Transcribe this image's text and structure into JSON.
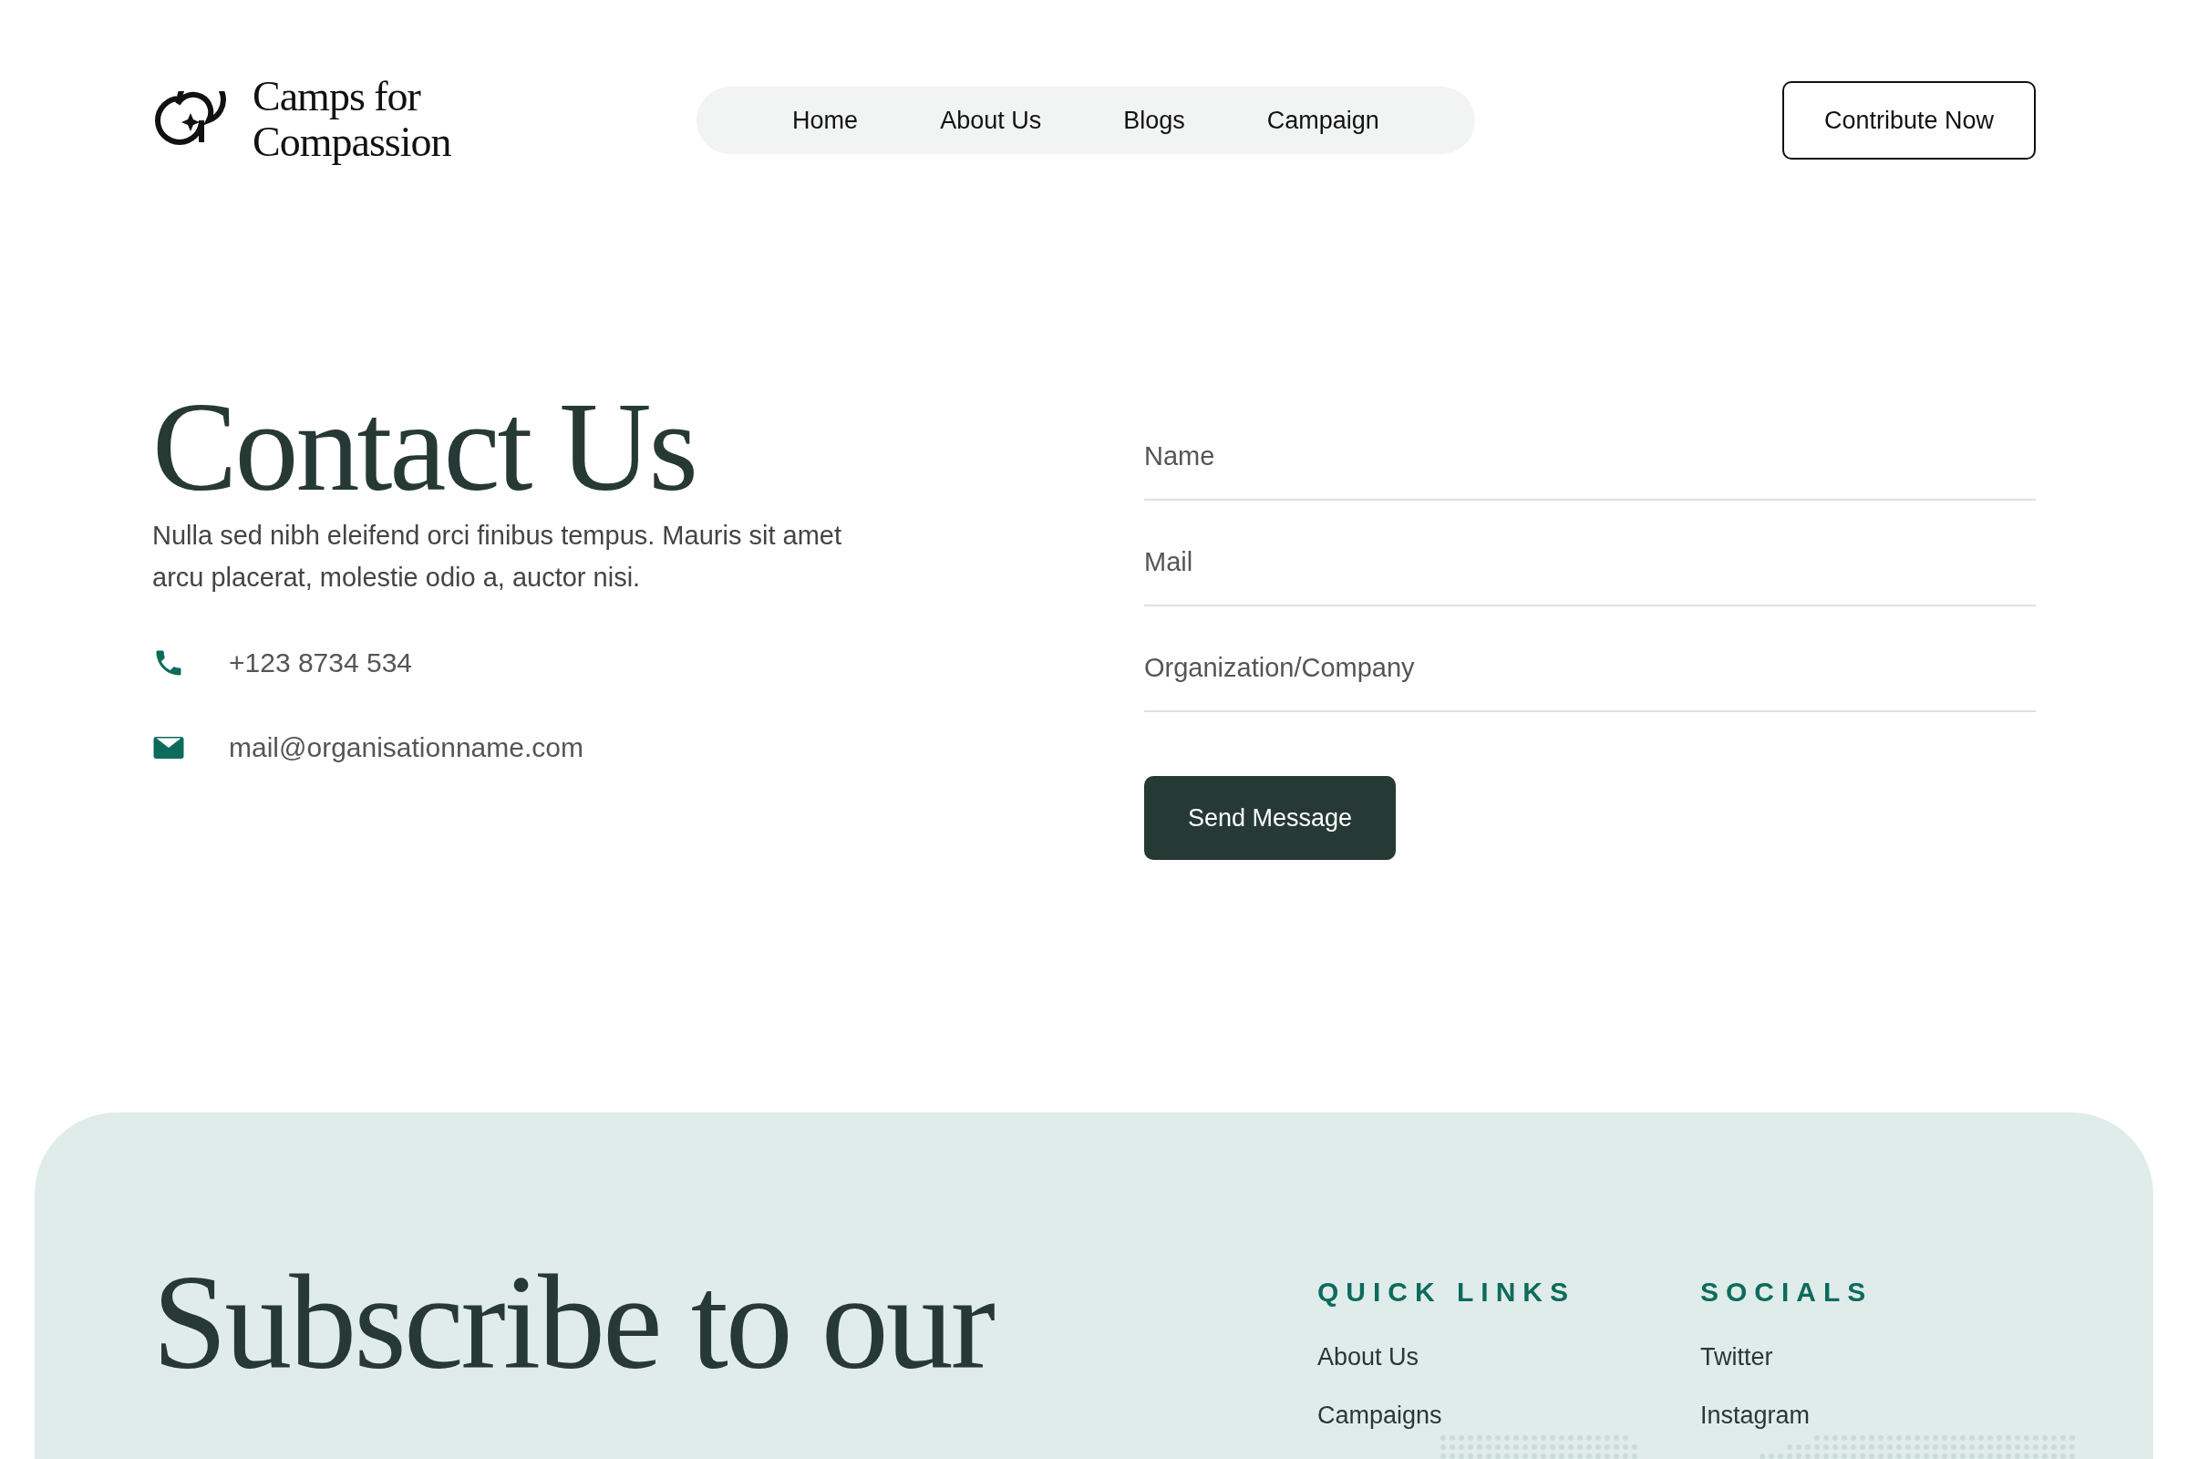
{
  "header": {
    "logo": {
      "line_1": "Camps for",
      "line_2": "Compassion"
    },
    "nav": [
      {
        "label": "Home"
      },
      {
        "label": "About Us"
      },
      {
        "label": "Blogs"
      },
      {
        "label": "Campaign"
      }
    ],
    "cta": "Contribute Now"
  },
  "contact": {
    "title": "Contact Us",
    "text": "Nulla sed nibh eleifend orci finibus tempus. Mauris sit amet arcu placerat, molestie odio a, auctor nisi.",
    "details": [
      {
        "kind": "phone",
        "text": "+123 8734 534"
      },
      {
        "kind": "mail",
        "text": "mail@organisationname.com"
      }
    ]
  },
  "form": {
    "fields": [
      {
        "placeholder": "Name"
      },
      {
        "placeholder": "Mail"
      },
      {
        "placeholder": "Organization/Company"
      }
    ],
    "submit": "Send Message"
  },
  "footer": {
    "heading": "Subscribe to our",
    "columns": [
      {
        "title": "QUICK LINKS",
        "links": [
          "About Us",
          "Campaigns"
        ]
      },
      {
        "title": "SOCIALS",
        "links": [
          "Twitter",
          "Instagram"
        ]
      }
    ]
  }
}
